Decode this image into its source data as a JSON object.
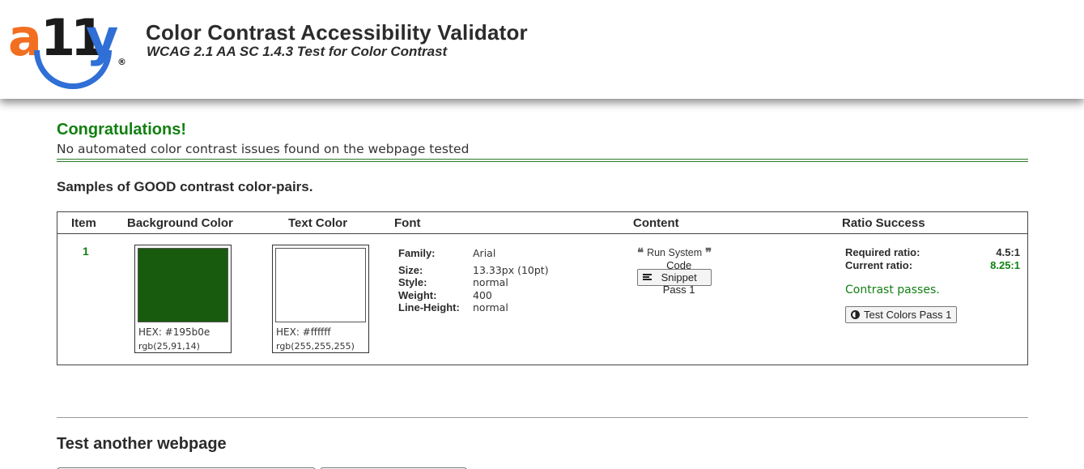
{
  "header": {
    "logo_text": "a11y",
    "logo_registered": "®",
    "title": "Color Contrast Accessibility Validator",
    "subtitle": "WCAG 2.1 AA SC 1.4.3 Test for Color Contrast"
  },
  "result": {
    "heading": "Congratulations!",
    "message": "No automated color contrast issues found on the webpage tested"
  },
  "samples_title": "Samples of GOOD contrast color-pairs.",
  "table": {
    "headers": {
      "item": "Item",
      "background": "Background Color",
      "text": "Text Color",
      "font": "Font",
      "content": "Content",
      "ratio": "Ratio Success"
    },
    "rows": [
      {
        "item": "1",
        "background": {
          "hex_label": "HEX: #195b0e",
          "rgb_label": "rgb(25,91,14)",
          "color": "#195b0e"
        },
        "text": {
          "hex_label": "HEX: #ffffff",
          "rgb_label": "rgb(255,255,255)",
          "color": "#ffffff"
        },
        "font": {
          "family_label": "Family:",
          "family": "Arial",
          "size_label": "Size:",
          "size": "13.33px (10pt)",
          "style_label": "Style:",
          "style": "normal",
          "weight_label": "Weight:",
          "weight": "400",
          "line_height_label": "Line-Height:",
          "line_height": "normal"
        },
        "content": {
          "quote_icon_open": "quote-left-icon",
          "text": "Run System",
          "quote_icon_close": "quote-right-icon",
          "snippet_button": "Code Snippet Pass 1",
          "snippet_icon": "align-left-icon"
        },
        "ratio": {
          "required_label": "Required ratio:",
          "required": "4.5:1",
          "current_label": "Current ratio:",
          "current": "8.25:1",
          "status": "Contrast passes.",
          "test_button": "Test Colors Pass 1",
          "test_icon": "contrast-icon"
        }
      }
    ]
  },
  "colors": {
    "success_green": "#128012",
    "logo_orange": "#f26f21",
    "logo_blue": "#2f6fd6",
    "text_dark": "#2b2b2b"
  },
  "test_another": {
    "heading": "Test another webpage"
  }
}
